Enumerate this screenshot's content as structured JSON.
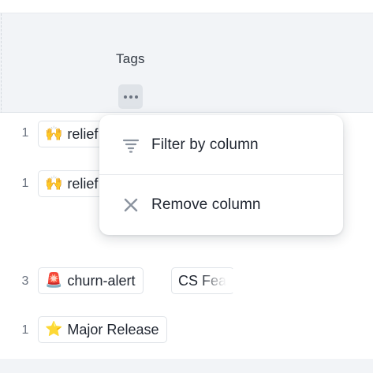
{
  "column": {
    "title": "Tags",
    "more_icon": "more-horizontal-icon"
  },
  "rows": [
    {
      "count": "1",
      "tags": [
        {
          "emoji": "🙌",
          "icon": "raised-hands-icon",
          "label": "relief"
        }
      ]
    },
    {
      "count": "1",
      "tags": [
        {
          "emoji": "🙌",
          "icon": "raised-hands-icon",
          "label": "relief"
        }
      ]
    },
    {
      "count": "3",
      "tags": [
        {
          "emoji": "🚨",
          "icon": "siren-icon",
          "label": "churn-alert"
        },
        {
          "emoji": "",
          "icon": "",
          "label": "CS Fea"
        }
      ]
    },
    {
      "count": "1",
      "tags": [
        {
          "emoji": "⭐",
          "icon": "star-icon",
          "label": "Major Release"
        }
      ]
    }
  ],
  "menu": {
    "items": [
      {
        "label": "Filter by column",
        "icon": "filter-icon"
      },
      {
        "label": "Remove column",
        "icon": "close-icon"
      }
    ]
  },
  "colors": {
    "header_bg": "#f2f4f7",
    "border": "#dfe3e8",
    "text": "#1f2530",
    "muted": "#6b7380",
    "icon": "#8a929e"
  }
}
